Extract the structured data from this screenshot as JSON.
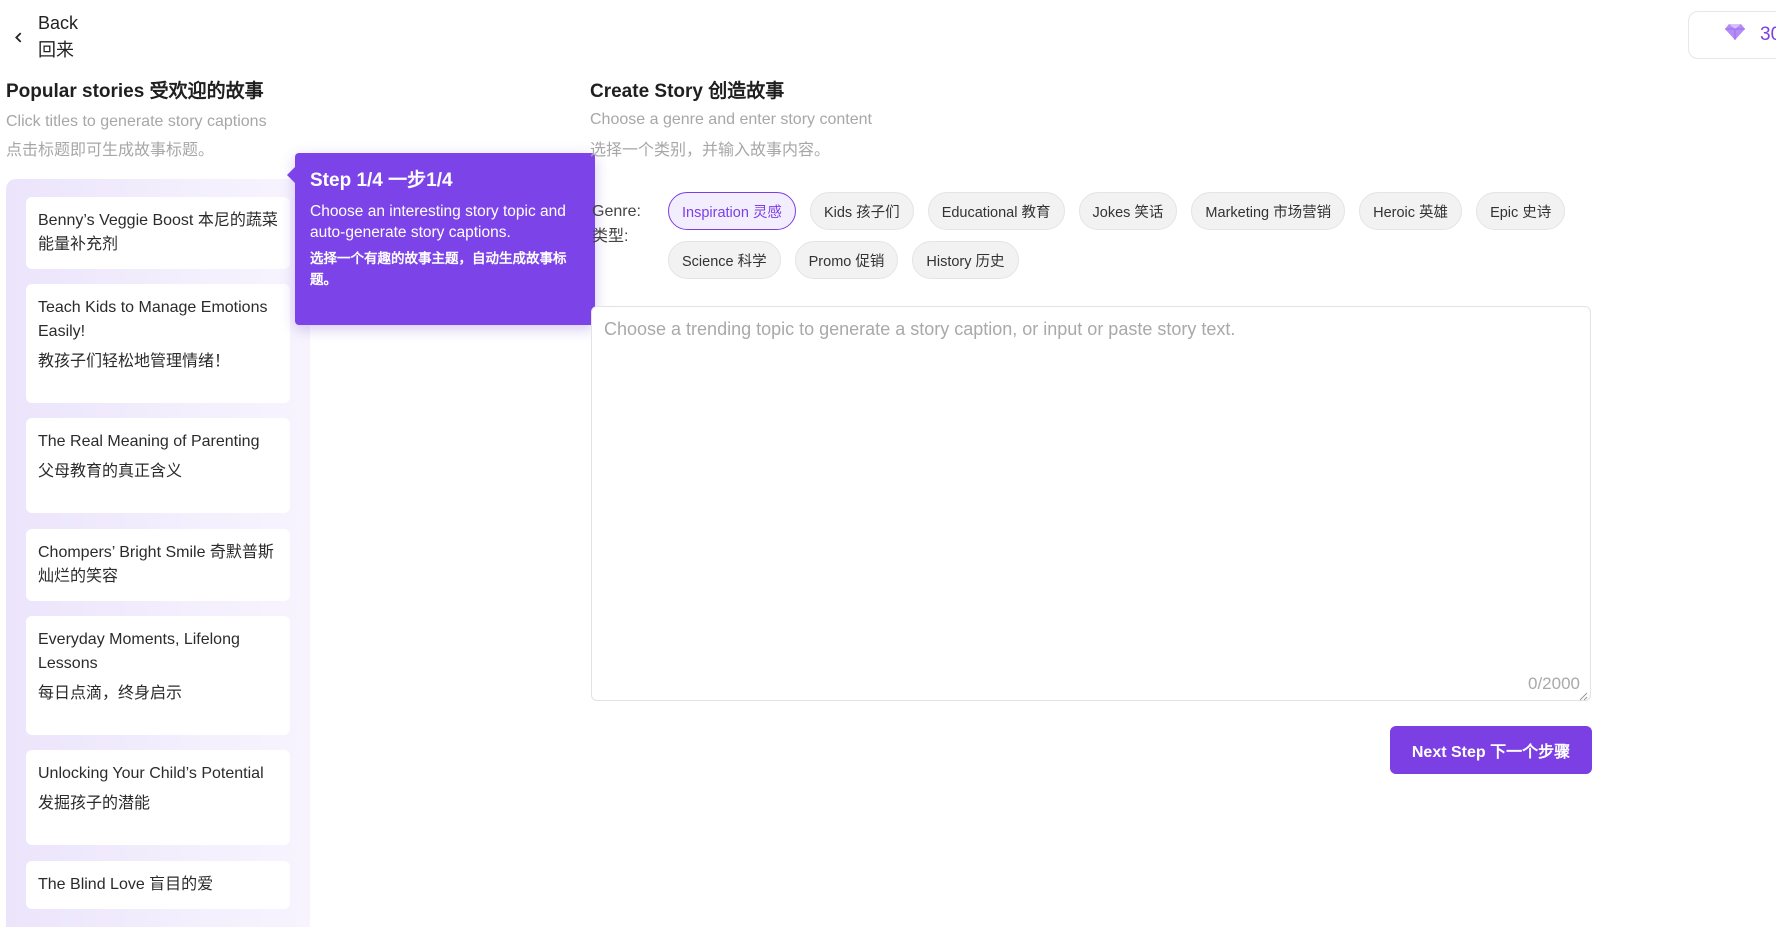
{
  "header": {
    "back_label_en": "Back",
    "back_label_cn": "回来",
    "credits_value": "30"
  },
  "popular": {
    "title": "Popular stories 受欢迎的故事",
    "subtitle_en": "Click titles to generate story captions",
    "subtitle_cn": "点击标题即可生成故事标题。",
    "stories": [
      {
        "en": "Benny’s Veggie Boost 本尼的蔬菜能量补充剂",
        "cn": ""
      },
      {
        "en": "Teach Kids to Manage Emotions Easily!",
        "cn": "教孩子们轻松地管理情绪！"
      },
      {
        "en": "The Real Meaning of Parenting",
        "cn": "父母教育的真正含义"
      },
      {
        "en": "Chompers’ Bright Smile 奇默普斯灿烂的笑容",
        "cn": ""
      },
      {
        "en": "Everyday Moments, Lifelong Lessons",
        "cn": "每日点滴，终身启示"
      },
      {
        "en": "Unlocking Your Child’s Potential",
        "cn": "发掘孩子的潜能"
      },
      {
        "en": "The Blind Love 盲目的爱",
        "cn": ""
      }
    ]
  },
  "tooltip": {
    "title": "Step 1/4 一步1/4",
    "text_en": "Choose an interesting story topic and auto-generate story captions.",
    "text_cn": "选择一个有趣的故事主题，自动生成故事标题。"
  },
  "create": {
    "title": "Create Story 创造故事",
    "subtitle_en": "Choose a genre and enter story content",
    "subtitle_cn": "选择一个类别，并输入故事内容。",
    "genre_label_en": "Genre:",
    "genre_label_cn": "类型:",
    "genres_row1": [
      "Inspiration 灵感",
      "Kids 孩子们",
      "Educational 教育",
      "Jokes 笑话",
      "Marketing 市场营销",
      "Heroic 英雄",
      "Epic 史诗"
    ],
    "genres_row2": [
      "Science 科学",
      "Promo 促销",
      "History 历史"
    ],
    "selected_genre": "Inspiration 灵感",
    "textarea_placeholder": "Choose a trending topic to generate a story caption, or input or paste story text.",
    "textarea_value": "",
    "char_count": "0/2000",
    "next_button": "Next Step 下一个步骤"
  },
  "colors": {
    "accent": "#7b3fe4",
    "panel_bg": "#ece4fb",
    "muted_text": "#a7a7a7"
  }
}
